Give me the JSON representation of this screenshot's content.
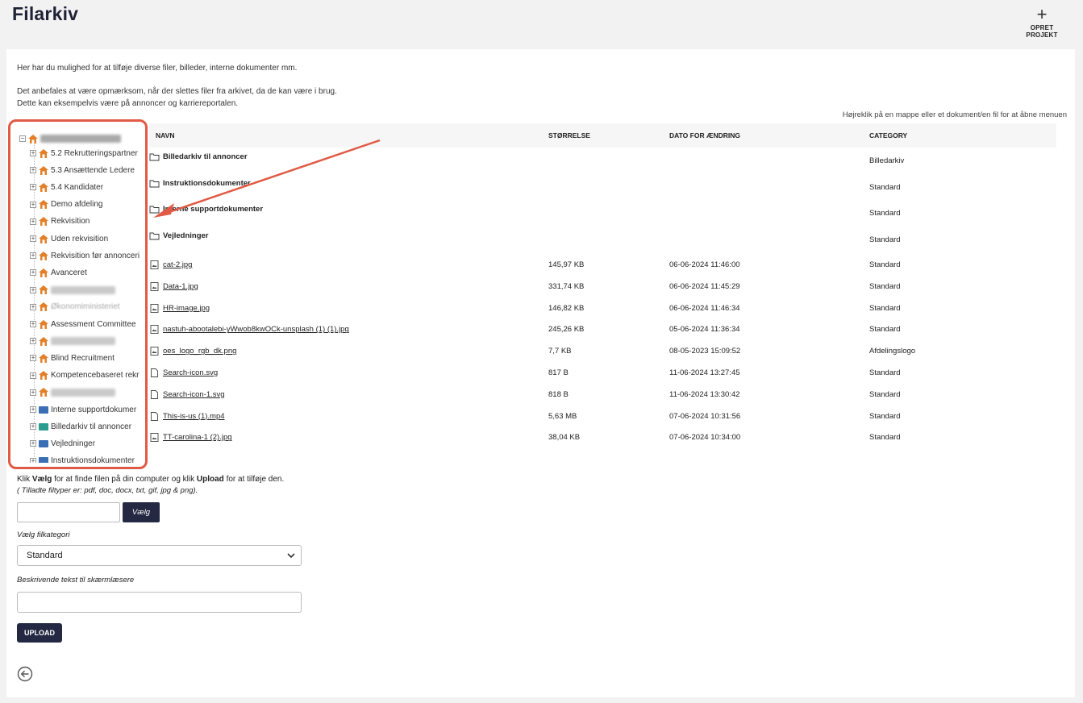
{
  "header": {
    "title": "Filarkiv",
    "create_project_icon": "plus-icon",
    "create_project_label": "OPRET PROJEKT"
  },
  "intro": {
    "line1": "Her har du mulighed for at tilføje diverse filer, billeder, interne dokumenter mm.",
    "line2": "Det anbefales at være opmærksom, når der slettes filer fra arkivet, da de kan være i brug.",
    "line3": "Dette kan eksempelvis være på annoncer og karriereportalen."
  },
  "hint": "Højreklik på en mappe eller et dokument/en fil for at åbne menuen",
  "tree": {
    "items": [
      {
        "label": "5.2 Rekrutteringspartner",
        "type": "unit"
      },
      {
        "label": "5.3 Ansættende Ledere",
        "type": "unit"
      },
      {
        "label": "5.4 Kandidater",
        "type": "unit"
      },
      {
        "label": "Demo afdeling",
        "type": "unit"
      },
      {
        "label": "Rekvisition",
        "type": "unit"
      },
      {
        "label": "Uden rekvisition",
        "type": "unit"
      },
      {
        "label": "Rekvisition før annonceri",
        "type": "unit"
      },
      {
        "label": "Avanceret",
        "type": "unit"
      },
      {
        "label": "",
        "type": "unit",
        "blurred": true
      },
      {
        "label": "Økonomiministeriet",
        "type": "unit",
        "faded": true
      },
      {
        "label": "Assessment Committee",
        "type": "unit"
      },
      {
        "label": "",
        "type": "unit",
        "blurred": true
      },
      {
        "label": "Blind Recruitment",
        "type": "unit"
      },
      {
        "label": "Kompetencebaseret rekr",
        "type": "unit"
      },
      {
        "label": "",
        "type": "unit",
        "blurred": true
      },
      {
        "label": "Interne supportdokumer",
        "type": "folder",
        "color": "#3a6fb5"
      },
      {
        "label": "Billedarkiv til annoncer",
        "type": "folder",
        "color": "#2a9d8f"
      },
      {
        "label": "Vejledninger",
        "type": "folder",
        "color": "#3a6fb5"
      },
      {
        "label": "Instruktionsdokumenter",
        "type": "folder",
        "color": "#3a6fb5"
      }
    ]
  },
  "table": {
    "headers": {
      "name": "NAVN",
      "size": "STØRRELSE",
      "date": "DATO FOR ÆNDRING",
      "category": "CATEGORY"
    },
    "rows": [
      {
        "name": "Billedarkiv til annoncer",
        "kind": "folder",
        "size": "",
        "date": "",
        "category": "Billedarkiv"
      },
      {
        "name": "Instruktionsdokumenter",
        "kind": "folder",
        "size": "",
        "date": "",
        "category": "Standard"
      },
      {
        "name": "Interne supportdokumenter",
        "kind": "folder",
        "size": "",
        "date": "",
        "category": "Standard"
      },
      {
        "name": "Vejledninger",
        "kind": "folder",
        "size": "",
        "date": "",
        "category": "Standard"
      },
      {
        "name": "cat-2.jpg",
        "kind": "image",
        "size": "145,97 KB",
        "date": "06-06-2024 11:46:00",
        "category": "Standard"
      },
      {
        "name": "Data-1.jpg",
        "kind": "image",
        "size": "331,74 KB",
        "date": "06-06-2024 11:45:29",
        "category": "Standard"
      },
      {
        "name": "HR-image.jpg",
        "kind": "image",
        "size": "146,82 KB",
        "date": "06-06-2024 11:46:34",
        "category": "Standard"
      },
      {
        "name": "nastuh-abootalebi-yWwob8kwOCk-unsplash (1) (1).jpg",
        "kind": "image",
        "size": "245,26 KB",
        "date": "05-06-2024 11:36:34",
        "category": "Standard"
      },
      {
        "name": "oes_logo_rgb_dk.png",
        "kind": "image",
        "size": "7,7 KB",
        "date": "08-05-2023 15:09:52",
        "category": "Afdelingslogo"
      },
      {
        "name": "Search-icon.svg",
        "kind": "doc",
        "size": "817 B",
        "date": "11-06-2024 13:27:45",
        "category": "Standard"
      },
      {
        "name": "Search-icon-1.svg",
        "kind": "doc",
        "size": "818 B",
        "date": "11-06-2024 13:30:42",
        "category": "Standard"
      },
      {
        "name": "This-is-us (1).mp4",
        "kind": "doc",
        "size": "5,63 MB",
        "date": "07-06-2024 10:31:56",
        "category": "Standard"
      },
      {
        "name": "TT-carolina-1 (2).jpg",
        "kind": "image",
        "size": "38,04 KB",
        "date": "07-06-2024 10:34:00",
        "category": "Standard"
      }
    ]
  },
  "upload": {
    "instr_pre": "Klik ",
    "instr_bold1": "Vælg",
    "instr_mid": " for at finde filen på din computer og klik ",
    "instr_bold2": "Upload",
    "instr_post": " for at tilføje den.",
    "filetypes": "( Tilladte filtyper er: pdf, doc, docx, txt, gif, jpg & png).",
    "choose_label": "Vælg",
    "category_label": "Vælg filkategori",
    "category_value": "Standard",
    "desc_label": "Beskrivende tekst til skærmlæsere",
    "upload_label": "UPLOAD",
    "back_icon": "back-arrow-icon"
  },
  "colors": {
    "accent": "#242842",
    "highlight": "#e05a45",
    "house": "#e2802a"
  }
}
